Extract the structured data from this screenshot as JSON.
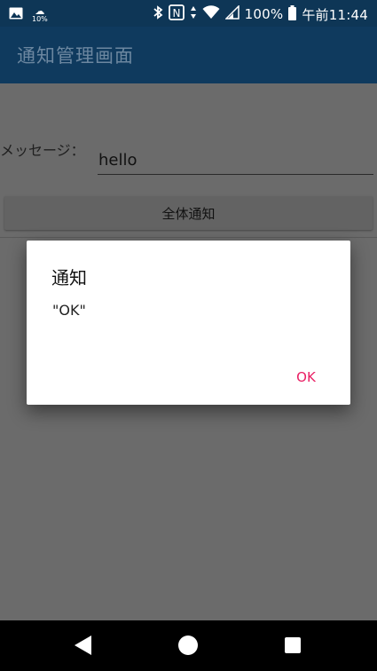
{
  "status_bar": {
    "weather_text": "10%",
    "battery_text": "100%",
    "time_text": "午前11:44",
    "icons": [
      "image-icon",
      "weather-icon",
      "bluetooth-icon",
      "nfc-icon",
      "data-arrows-icon",
      "wifi-icon",
      "signal-icon"
    ]
  },
  "app_bar": {
    "title": "通知管理画面"
  },
  "form": {
    "message_label": "メッセージ：",
    "message_value": "hello",
    "broadcast_button": "全体通知"
  },
  "dialog": {
    "title": "通知",
    "message": "\"OK\"",
    "ok_button": "OK",
    "accent_color": "#e91e63"
  },
  "nav_bar": {
    "icons": [
      "back-icon",
      "home-icon",
      "recents-icon"
    ]
  }
}
